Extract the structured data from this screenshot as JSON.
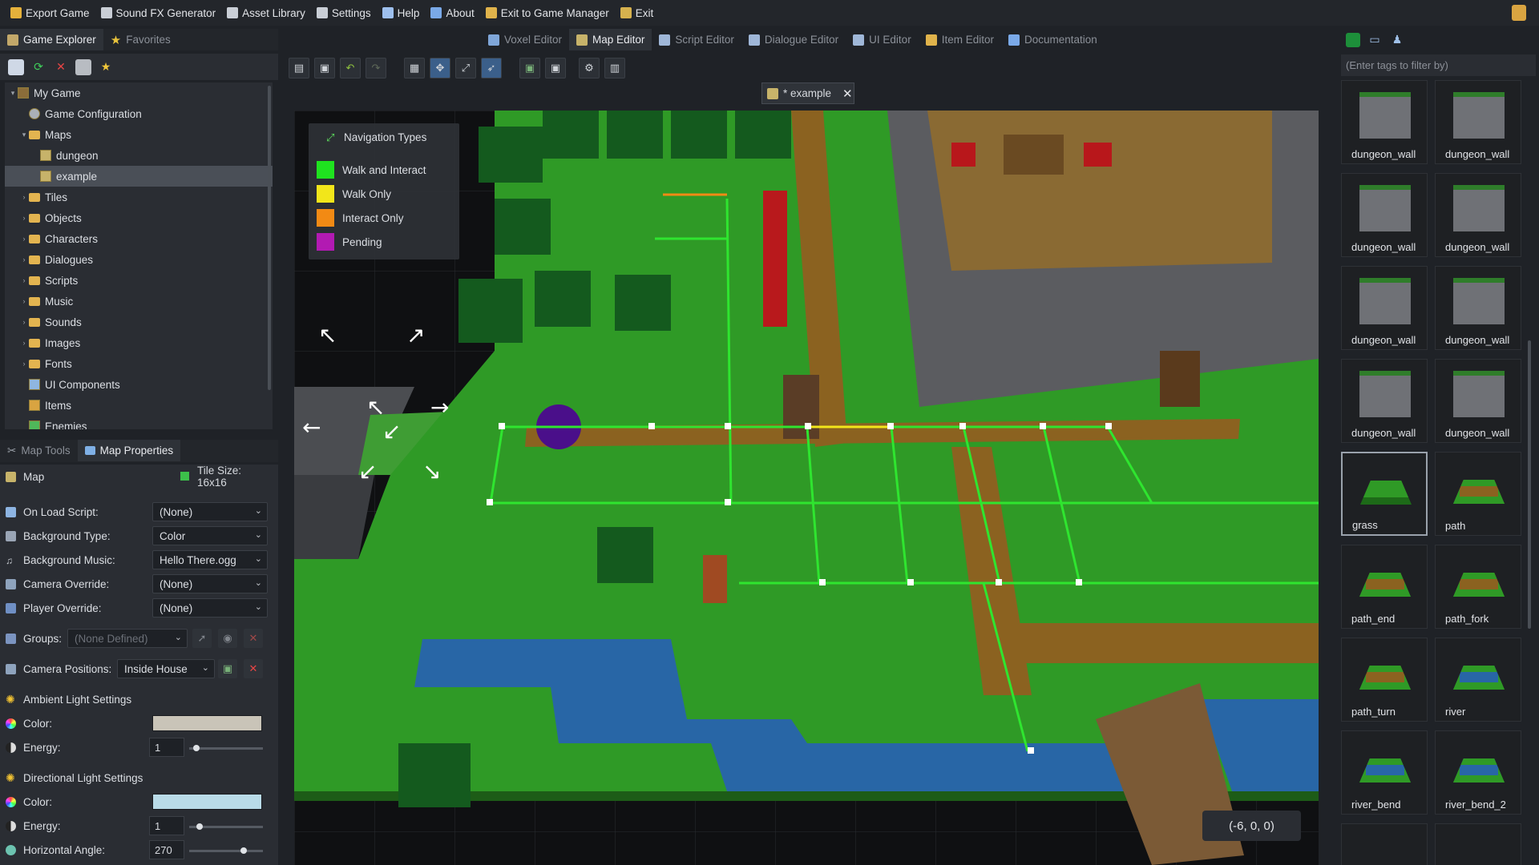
{
  "menubar": {
    "items": [
      {
        "label": "Export Game",
        "icon": "export-icon",
        "color": "#e5b13b"
      },
      {
        "label": "Sound FX Generator",
        "icon": "speaker-icon",
        "color": "#c9ced6"
      },
      {
        "label": "Asset Library",
        "icon": "cart-icon",
        "color": "#c9ced6"
      },
      {
        "label": "Settings",
        "icon": "settings-icon",
        "color": "#c9ced6"
      },
      {
        "label": "Help",
        "icon": "help-icon",
        "color": "#9ec0ee"
      },
      {
        "label": "About",
        "icon": "info-icon",
        "color": "#7aa9e8"
      },
      {
        "label": "Exit to Game Manager",
        "icon": "exit-manager-icon",
        "color": "#e0b34b"
      },
      {
        "label": "Exit",
        "icon": "exit-icon",
        "color": "#d6b14e"
      }
    ]
  },
  "left_tabs": [
    {
      "label": "Game Explorer",
      "active": true
    },
    {
      "label": "Favorites",
      "active": false
    }
  ],
  "tree": {
    "root": "My Game",
    "items": [
      {
        "label": "Game Configuration",
        "type": "config",
        "indent": 1
      },
      {
        "label": "Maps",
        "type": "folder-open",
        "indent": 1
      },
      {
        "label": "dungeon",
        "type": "map",
        "indent": 2
      },
      {
        "label": "example",
        "type": "map",
        "indent": 2,
        "selected": true
      },
      {
        "label": "Tiles",
        "type": "folder",
        "indent": 1
      },
      {
        "label": "Objects",
        "type": "folder",
        "indent": 1
      },
      {
        "label": "Characters",
        "type": "folder",
        "indent": 1
      },
      {
        "label": "Dialogues",
        "type": "folder",
        "indent": 1
      },
      {
        "label": "Scripts",
        "type": "folder",
        "indent": 1
      },
      {
        "label": "Music",
        "type": "folder",
        "indent": 1
      },
      {
        "label": "Sounds",
        "type": "folder",
        "indent": 1
      },
      {
        "label": "Images",
        "type": "folder",
        "indent": 1
      },
      {
        "label": "Fonts",
        "type": "folder",
        "indent": 1
      },
      {
        "label": "UI Components",
        "type": "ui",
        "indent": 1
      },
      {
        "label": "Items",
        "type": "items",
        "indent": 1
      },
      {
        "label": "Enemies",
        "type": "enemies",
        "indent": 1
      }
    ]
  },
  "lower_tabs": [
    {
      "label": "Map Tools",
      "active": false
    },
    {
      "label": "Map Properties",
      "active": true
    }
  ],
  "map_props": {
    "header": "Map",
    "tile_size": "Tile Size: 16x16",
    "on_load_script_label": "On Load Script:",
    "on_load_script": "(None)",
    "background_type_label": "Background Type:",
    "background_type": "Color",
    "background_music_label": "Background Music:",
    "background_music": "Hello There.ogg",
    "camera_override_label": "Camera Override:",
    "camera_override": "(None)",
    "player_override_label": "Player Override:",
    "player_override": "(None)",
    "groups_label": "Groups:",
    "groups": "(None Defined)",
    "camera_positions_label": "Camera Positions:",
    "camera_positions": "Inside House",
    "ambient_header": "Ambient Light Settings",
    "ambient_color_label": "Color:",
    "ambient_color": "#c9c4b8",
    "ambient_energy_label": "Energy:",
    "ambient_energy": "1",
    "ambient_energy_level": 0.05,
    "directional_header": "Directional Light Settings",
    "directional_color_label": "Color:",
    "directional_color": "#b9dbe8",
    "directional_energy_label": "Energy:",
    "directional_energy": "1",
    "directional_energy_level": 0.1,
    "horizontal_angle_label": "Horizontal Angle:",
    "horizontal_angle": "270",
    "horizontal_angle_level": 0.7
  },
  "editor_tabs": [
    {
      "label": "Voxel Editor",
      "active": false
    },
    {
      "label": "Map Editor",
      "active": true
    },
    {
      "label": "Script Editor",
      "active": false
    },
    {
      "label": "Dialogue Editor",
      "active": false
    },
    {
      "label": "UI Editor",
      "active": false
    },
    {
      "label": "Item Editor",
      "active": false
    },
    {
      "label": "Documentation",
      "active": false
    }
  ],
  "document_tab": {
    "label": "* example"
  },
  "nav_legend": {
    "title": "Navigation Types",
    "items": [
      {
        "label": "Walk and Interact",
        "color": "#1fe21f"
      },
      {
        "label": "Walk Only",
        "color": "#f2e61a"
      },
      {
        "label": "Interact Only",
        "color": "#f28a14"
      },
      {
        "label": "Pending",
        "color": "#b21ab2"
      }
    ]
  },
  "coordinates": "(-6, 0, 0)",
  "asset_filter": {
    "placeholder": "(Enter tags to filter by)"
  },
  "assets": [
    {
      "label": "dungeon_wall",
      "kind": "wall"
    },
    {
      "label": "dungeon_wall",
      "kind": "wall"
    },
    {
      "label": "dungeon_wall",
      "kind": "wall"
    },
    {
      "label": "dungeon_wall",
      "kind": "wall"
    },
    {
      "label": "dungeon_wall",
      "kind": "wall"
    },
    {
      "label": "dungeon_wall",
      "kind": "wall"
    },
    {
      "label": "dungeon_wall",
      "kind": "wall"
    },
    {
      "label": "dungeon_wall",
      "kind": "wall"
    },
    {
      "label": "grass",
      "kind": "grass",
      "selected": true
    },
    {
      "label": "path",
      "kind": "path"
    },
    {
      "label": "path_end",
      "kind": "path"
    },
    {
      "label": "path_fork",
      "kind": "path"
    },
    {
      "label": "path_turn",
      "kind": "path"
    },
    {
      "label": "river",
      "kind": "river"
    },
    {
      "label": "river_bend",
      "kind": "river"
    },
    {
      "label": "river_bend_2",
      "kind": "river"
    }
  ]
}
